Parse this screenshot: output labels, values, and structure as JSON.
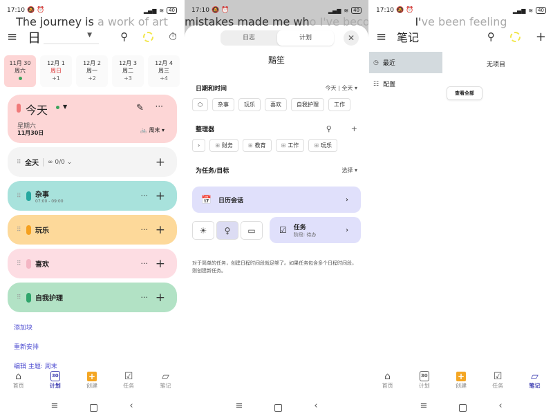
{
  "status_bar": {
    "time": "17:10",
    "battery": "40"
  },
  "panel_plan": {
    "lyric_dark": "The journey is ",
    "lyric_dim": "a work of art",
    "view_title": "日",
    "days": [
      {
        "date": "11月 30",
        "weekday": "周六",
        "sub": "",
        "selected": true,
        "has_dot": true,
        "weekday_red": false
      },
      {
        "date": "12月 1",
        "weekday": "周日",
        "sub": "+1",
        "selected": false,
        "has_dot": false,
        "weekday_red": true
      },
      {
        "date": "12月 2",
        "weekday": "周一",
        "sub": "+2",
        "selected": false,
        "has_dot": false,
        "weekday_red": false
      },
      {
        "date": "12月 3",
        "weekday": "周二",
        "sub": "+3",
        "selected": false,
        "has_dot": false,
        "weekday_red": false
      },
      {
        "date": "12月 4",
        "weekday": "周三",
        "sub": "+4",
        "selected": false,
        "has_dot": false,
        "weekday_red": false
      }
    ],
    "today_card": {
      "title": "今天",
      "weekday": "星期六",
      "date": "11月30日",
      "theme": "周末"
    },
    "allday": {
      "label": "全天",
      "progress": "0/0"
    },
    "blocks": [
      {
        "name": "杂事",
        "time": "07:00 - 09:00",
        "bg": "#a8e2dc",
        "pill": "#26a8a0"
      },
      {
        "name": "玩乐",
        "time": "",
        "bg": "#fdd99a",
        "pill": "#f5a01e"
      },
      {
        "name": "喜欢",
        "time": "",
        "bg": "#fddde3",
        "pill": "#f4b6c4"
      },
      {
        "name": "自我护理",
        "time": "",
        "bg": "#b2e2c5",
        "pill": "#2fa56b"
      }
    ],
    "links": [
      "添加块",
      "重新安排",
      "编辑 主题: 周末"
    ]
  },
  "bottom_nav": {
    "items": [
      {
        "label": "首页",
        "icon": "home-icon"
      },
      {
        "label": "计划",
        "icon": "calendar-icon",
        "badge": "30"
      },
      {
        "label": "创建",
        "icon": "plus-box-icon"
      },
      {
        "label": "任务",
        "icon": "clipboard-check-icon"
      },
      {
        "label": "笔记",
        "icon": "note-icon"
      }
    ]
  },
  "panel_create": {
    "lyric_dark": "mistakes made me wh",
    "lyric_dim": "o I've become",
    "tabs": [
      "日志",
      "计划"
    ],
    "active_tab": "计划",
    "title": "黯笙",
    "date_section": {
      "label": "日期和时间",
      "value": "今天 | 全天"
    },
    "block_chips": [
      "杂事",
      "玩乐",
      "喜欢",
      "自我护理",
      "工作"
    ],
    "organizer_section": {
      "label": "整理器"
    },
    "organizer_chips": [
      "财务",
      "教育",
      "工作",
      "玩乐"
    ],
    "goal_section": {
      "label": "为任务/目标",
      "value": "选择"
    },
    "calendar_session": "日历会话",
    "task_card": {
      "title": "任务",
      "subtitle": "阶段: 待办"
    },
    "hint": "对于简单的任务，创建日程时间段就足够了。如果任务包含多个日程时间段，则创建新任务。"
  },
  "panel_notes": {
    "lyric_dark": "I'",
    "lyric_dim": "ve been feeling",
    "title": "笔记",
    "sidebar": [
      "最近",
      "配置"
    ],
    "empty_text": "无项目",
    "view_all": "查看全部"
  }
}
